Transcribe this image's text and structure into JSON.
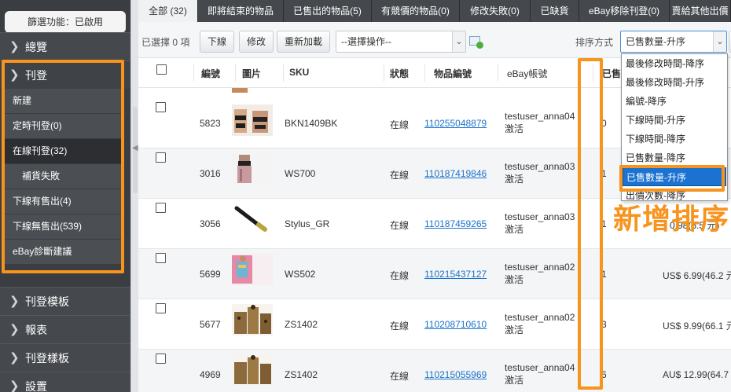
{
  "sidebar": {
    "filter_status": "篩選功能：已啟用",
    "groups": [
      {
        "label": "總覽"
      },
      {
        "label": "刊登"
      },
      {
        "label": "刊登模板"
      },
      {
        "label": "報表"
      },
      {
        "label": "刊登樣板"
      },
      {
        "label": "設置"
      }
    ],
    "listing_items": [
      {
        "label": "新建"
      },
      {
        "label": "定時刊登(0)"
      },
      {
        "label": "在線刊登(32)"
      },
      {
        "label": "補貨失敗"
      },
      {
        "label": "下線有售出(4)"
      },
      {
        "label": "下線無售出(539)"
      },
      {
        "label": "eBay診斷建議"
      }
    ]
  },
  "tabs": [
    {
      "label": "全部 (32)"
    },
    {
      "label": "即將結束的物品"
    },
    {
      "label": "已售出的物品(5)"
    },
    {
      "label": "有競價的物品(0)"
    },
    {
      "label": "修改失敗(0)"
    },
    {
      "label": "已缺貨"
    },
    {
      "label": "eBay移除刊登(0)"
    },
    {
      "label": "賣給其他出價"
    }
  ],
  "toolbar": {
    "selected_count": "已選擇 0 項",
    "offline_button": "下線",
    "edit_button": "修改",
    "reload_button": "重新加載",
    "action_select": "--選擇操作--",
    "sort_label": "排序方式",
    "sort_value": "已售數量-升序"
  },
  "sort_options": [
    {
      "label": "最後修改時間-降序"
    },
    {
      "label": "最後修改時間-升序"
    },
    {
      "label": "編號-降序"
    },
    {
      "label": "下線時間-升序"
    },
    {
      "label": "下線時間-降序"
    },
    {
      "label": "已售數量-降序"
    },
    {
      "label": "已售數量-升序"
    },
    {
      "label": "出價次數-降序"
    }
  ],
  "table": {
    "headers": {
      "number": "編號",
      "image": "圖片",
      "sku": "SKU",
      "status": "狀態",
      "item_id": "物品編號",
      "account": "eBay帳號",
      "sold": "已售"
    },
    "rows": [
      {
        "number": "5823",
        "sku": "BKN1409BK",
        "status": "在線",
        "item_id": "110255048879",
        "account": "testuser_anna04",
        "account_status": "激活",
        "sold": "0",
        "price": ""
      },
      {
        "number": "3016",
        "sku": "WS700",
        "status": "在線",
        "item_id": "110187419846",
        "account": "testuser_anna03",
        "account_status": "激活",
        "sold": "1",
        "price": ""
      },
      {
        "number": "3056",
        "sku": "Stylus_GR",
        "status": "在線",
        "item_id": "110187459265",
        "account": "testuser_anna03",
        "account_status": "激活",
        "sold": "1",
        "price": "0.98(6.5 元)"
      },
      {
        "number": "5699",
        "sku": "WS502",
        "status": "在線",
        "item_id": "110215437127",
        "account": "testuser_anna02",
        "account_status": "激活",
        "sold": "1",
        "price": "US$ 6.99(46.2 元"
      },
      {
        "number": "5677",
        "sku": "ZS1402",
        "status": "在線",
        "item_id": "110208710610",
        "account": "testuser_anna02",
        "account_status": "激活",
        "sold": "3",
        "price": "US$ 9.99(66.1 元"
      },
      {
        "number": "4969",
        "sku": "ZS1402",
        "status": "在線",
        "item_id": "110215055969",
        "account": "testuser_anna04",
        "account_status": "激活",
        "sold": "6",
        "price": "AU$ 12.99(64.7"
      }
    ]
  },
  "annotation": "新增排序",
  "colors": {
    "highlight": "#f7941d",
    "sidebar_bg": "#3a3d41",
    "link": "#1a73c9",
    "selected_option": "#1b72d1"
  }
}
